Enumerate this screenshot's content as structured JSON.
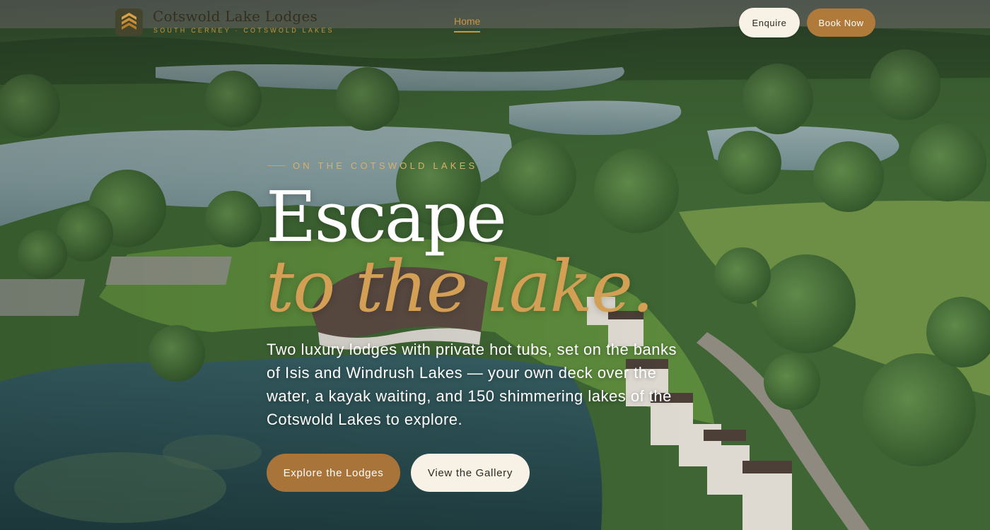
{
  "header": {
    "brand_name": "Cotswold Lake Lodges",
    "brand_sub": "SOUTH CERNEY · COTSWOLD LAKES",
    "nav": [
      {
        "label": "Home",
        "active": true
      }
    ],
    "enquire_label": "Enquire",
    "book_label": "Book Now"
  },
  "hero": {
    "eyebrow": "ON THE COTSWOLD LAKES",
    "title_line1": "Escape",
    "title_line2": "to the lake.",
    "lede": "Two luxury lodges with private hot tubs, set on the banks of Isis and Windrush Lakes — your own deck over the water, a kayak waiting, and 150 shimmering lakes of the Cotswold Lakes to explore.",
    "explore_label": "Explore the Lodges",
    "gallery_label": "View the Gallery"
  },
  "colors": {
    "accent": "#c9973f",
    "primary_button": "#a9743a",
    "light_button": "#f7f1e6",
    "title_white": "#ffffff",
    "title_gold": "#d29f55"
  },
  "icons": {
    "logo": "stacked-chevrons-logo-icon"
  }
}
